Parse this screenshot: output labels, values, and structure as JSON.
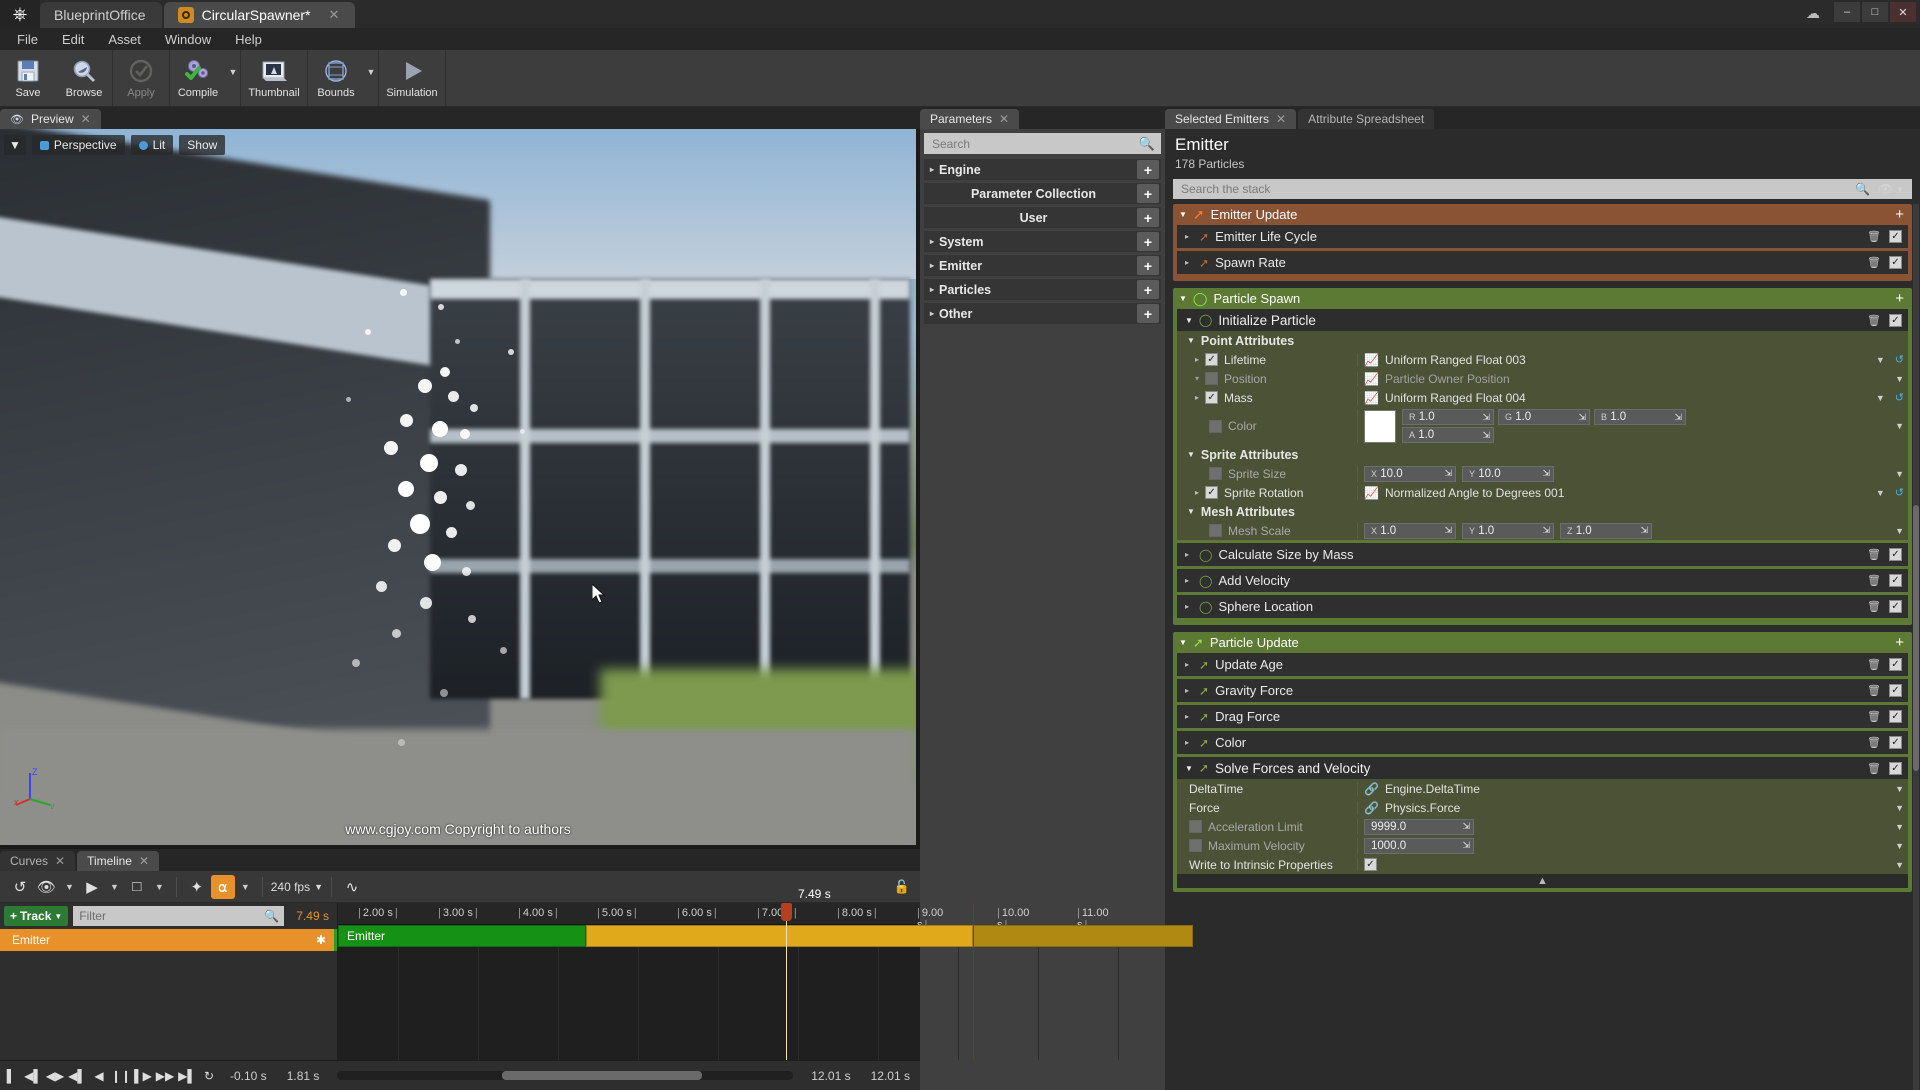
{
  "window": {
    "tabs": [
      {
        "label": "BlueprintOffice",
        "active": false,
        "icon": "none"
      },
      {
        "label": "CircularSpawner*",
        "active": true,
        "icon": "niagara-asset-icon"
      }
    ],
    "controls": {
      "minimize": "–",
      "maximize": "□",
      "close": "✕",
      "cloud": "☁"
    }
  },
  "menu": [
    "File",
    "Edit",
    "Asset",
    "Window",
    "Help"
  ],
  "toolbar": {
    "buttons": [
      {
        "label": "Save",
        "icon": "save-icon",
        "disabled": false,
        "arrow": false
      },
      {
        "label": "Browse",
        "icon": "browse-icon",
        "disabled": false,
        "arrow": false
      },
      {
        "label": "Apply",
        "icon": "apply-icon",
        "disabled": true,
        "arrow": false
      },
      {
        "label": "Compile",
        "icon": "compile-icon",
        "disabled": false,
        "arrow": true
      },
      {
        "label": "Thumbnail",
        "icon": "thumbnail-icon",
        "disabled": false,
        "arrow": false
      },
      {
        "label": "Bounds",
        "icon": "bounds-icon",
        "disabled": false,
        "arrow": true
      },
      {
        "label": "Simulation",
        "icon": "simulation-icon",
        "disabled": false,
        "arrow": false
      }
    ]
  },
  "preview": {
    "tab_label": "Preview",
    "viewmode": "Perspective",
    "lighting": "Lit",
    "show": "Show",
    "watermark": "www.cgjoy.com Copyright to authors",
    "axis": {
      "z": "Z",
      "y": "y",
      "x": "x"
    }
  },
  "parameters": {
    "tab_label": "Parameters",
    "search_placeholder": "Search",
    "rows": [
      {
        "label": "Engine",
        "expandable": true,
        "centered": false
      },
      {
        "label": "Parameter Collection",
        "expandable": false,
        "centered": true
      },
      {
        "label": "User",
        "expandable": false,
        "centered": true
      },
      {
        "label": "System",
        "expandable": true,
        "centered": false
      },
      {
        "label": "Emitter",
        "expandable": true,
        "centered": false
      },
      {
        "label": "Particles",
        "expandable": true,
        "centered": false
      },
      {
        "label": "Other",
        "expandable": true,
        "centered": false
      }
    ]
  },
  "stack": {
    "tabs": [
      {
        "label": "Selected Emitters",
        "active": true
      },
      {
        "label": "Attribute Spreadsheet",
        "active": false
      }
    ],
    "title": "Emitter",
    "subtitle": "178 Particles",
    "search_placeholder": "Search the stack",
    "groups": [
      {
        "name": "Emitter Update",
        "color": "emitter",
        "icon": "emitter-arrow-icon",
        "add": "+",
        "modules": [
          {
            "label": "Emitter Life Cycle",
            "checked": true
          },
          {
            "label": "Spawn Rate",
            "checked": true
          }
        ]
      },
      {
        "name": "Particle Spawn",
        "color": "spawn",
        "icon": "particle-circle-icon",
        "add": "+",
        "modules": [
          {
            "label": "Initialize Particle",
            "checked": true,
            "expanded": true,
            "sections": [
              {
                "title": "Point Attributes",
                "rows": [
                  {
                    "name": "Lifetime",
                    "check": "on",
                    "expand": true,
                    "value": "Uniform Ranged Float 003",
                    "vtype": "link",
                    "reset": true
                  },
                  {
                    "name": "Position",
                    "check": "off",
                    "expand": true,
                    "dim": true,
                    "value": "Particle Owner Position",
                    "vtype": "link-dim"
                  },
                  {
                    "name": "Mass",
                    "check": "on",
                    "expand": true,
                    "value": "Uniform Ranged Float 004",
                    "vtype": "link",
                    "reset": true
                  },
                  {
                    "name": "Color",
                    "check": "off",
                    "dim": true,
                    "vtype": "color",
                    "fields": [
                      {
                        "hd": "R",
                        "v": "1.0"
                      },
                      {
                        "hd": "G",
                        "v": "1.0"
                      },
                      {
                        "hd": "B",
                        "v": "1.0"
                      },
                      {
                        "hd": "A",
                        "v": "1.0"
                      }
                    ]
                  }
                ]
              },
              {
                "title": "Sprite Attributes",
                "rows": [
                  {
                    "name": "Sprite Size",
                    "check": "off",
                    "dim": true,
                    "vtype": "vec2",
                    "fields": [
                      {
                        "hd": "X",
                        "v": "10.0"
                      },
                      {
                        "hd": "Y",
                        "v": "10.0"
                      }
                    ]
                  },
                  {
                    "name": "Sprite Rotation",
                    "check": "on",
                    "expand": true,
                    "value": "Normalized Angle to Degrees 001",
                    "vtype": "link",
                    "reset": true
                  }
                ]
              },
              {
                "title": "Mesh Attributes",
                "rows": [
                  {
                    "name": "Mesh Scale",
                    "check": "off",
                    "dim": true,
                    "vtype": "vec3",
                    "fields": [
                      {
                        "hd": "X",
                        "v": "1.0"
                      },
                      {
                        "hd": "Y",
                        "v": "1.0"
                      },
                      {
                        "hd": "Z",
                        "v": "1.0"
                      }
                    ]
                  }
                ]
              }
            ]
          },
          {
            "label": "Calculate Size by Mass",
            "checked": true
          },
          {
            "label": "Add Velocity",
            "checked": true
          },
          {
            "label": "Sphere Location",
            "checked": true
          }
        ]
      },
      {
        "name": "Particle Update",
        "color": "update",
        "icon": "update-arrow-icon",
        "add": "+",
        "modules": [
          {
            "label": "Update Age",
            "checked": true
          },
          {
            "label": "Gravity Force",
            "checked": true
          },
          {
            "label": "Drag Force",
            "checked": true
          },
          {
            "label": "Color",
            "checked": true
          },
          {
            "label": "Solve Forces and Velocity",
            "checked": true,
            "expanded": true,
            "plainrows": [
              {
                "name": "DeltaTime",
                "value": "Engine.DeltaTime",
                "vtype": "pin"
              },
              {
                "name": "Force",
                "value": "Physics.Force",
                "vtype": "pin"
              },
              {
                "name": "Acceleration Limit",
                "check": "off",
                "dim": true,
                "vtype": "num",
                "fields": [
                  {
                    "v": "9999.0"
                  }
                ]
              },
              {
                "name": "Maximum Velocity",
                "check": "off",
                "dim": true,
                "vtype": "num",
                "fields": [
                  {
                    "v": "1000.0"
                  }
                ]
              },
              {
                "name": "Write to Intrinsic Properties",
                "vtype": "check",
                "checked": true
              }
            ]
          }
        ]
      }
    ]
  },
  "timeline": {
    "tabs": [
      {
        "label": "Curves",
        "active": false
      },
      {
        "label": "Timeline",
        "active": true
      }
    ],
    "toolbar": {
      "fps": "240 fps",
      "icons": [
        "undo-icon",
        "eye-icon",
        "play-mode-icon",
        "selection-icon",
        "keyframe-icon",
        "magnet-icon",
        "curve-editor-icon",
        "lock-icon"
      ]
    },
    "track_button": "Track",
    "filter_placeholder": "Filter",
    "current_time": "7.49 s",
    "track_name": "Emitter",
    "clip_name": "Emitter",
    "ruler_ticks": [
      "2.00 s",
      "3.00 s",
      "4.00 s",
      "5.00 s",
      "6.00 s",
      "7.00 s",
      "8.00 s",
      "9.00 s",
      "10.00 s",
      "11.00 s"
    ],
    "playhead_label": "7.49 s",
    "range_start": "-0.10 s",
    "range_in": "1.81 s",
    "range_out": "12.01 s",
    "range_end": "12.01 s"
  },
  "colors": {
    "accent_orange": "#e8912a",
    "emitter_group": "#8a5334",
    "spawn_group": "#5d7a34",
    "clip_green": "#23a021",
    "clip_yellow": "#e0a81b",
    "link_cyan": "#2fd2d8",
    "pin_magenta": "#d857d8"
  }
}
